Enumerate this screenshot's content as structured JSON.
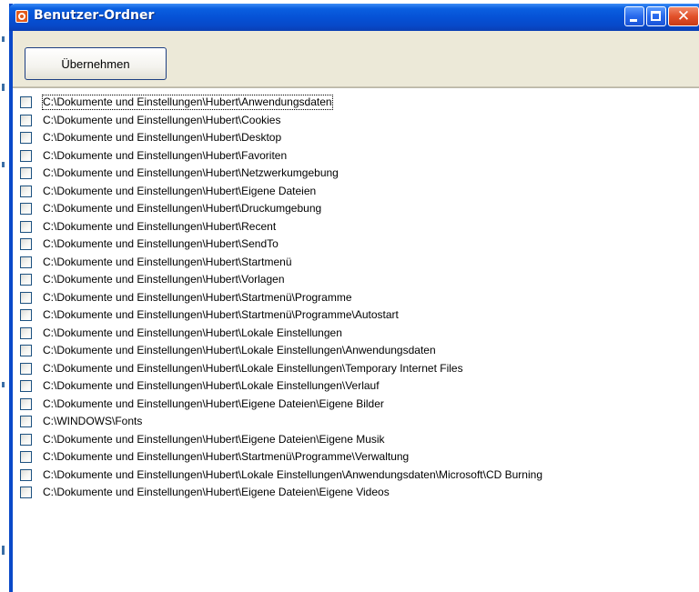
{
  "window": {
    "title": "Benutzer-Ordner",
    "close_glyph": "✕"
  },
  "toolbar": {
    "apply_label": "Übernehmen"
  },
  "colors": {
    "titlebar": "#0652d6",
    "toolbar_bg": "#ece9d8",
    "close_button": "#e2512a",
    "checkbox_border": "#1c5180"
  },
  "icons": {
    "app": "app-icon",
    "minimize": "minimize-icon",
    "maximize": "maximize-icon",
    "close": "close-icon"
  },
  "folders": [
    {
      "path": "C:\\Dokumente und Einstellungen\\Hubert\\Anwendungsdaten",
      "checked": false
    },
    {
      "path": "C:\\Dokumente und Einstellungen\\Hubert\\Cookies",
      "checked": false
    },
    {
      "path": "C:\\Dokumente und Einstellungen\\Hubert\\Desktop",
      "checked": false
    },
    {
      "path": "C:\\Dokumente und Einstellungen\\Hubert\\Favoriten",
      "checked": false
    },
    {
      "path": "C:\\Dokumente und Einstellungen\\Hubert\\Netzwerkumgebung",
      "checked": false
    },
    {
      "path": "C:\\Dokumente und Einstellungen\\Hubert\\Eigene Dateien",
      "checked": false
    },
    {
      "path": "C:\\Dokumente und Einstellungen\\Hubert\\Druckumgebung",
      "checked": false
    },
    {
      "path": "C:\\Dokumente und Einstellungen\\Hubert\\Recent",
      "checked": false
    },
    {
      "path": "C:\\Dokumente und Einstellungen\\Hubert\\SendTo",
      "checked": false
    },
    {
      "path": "C:\\Dokumente und Einstellungen\\Hubert\\Startmenü",
      "checked": false
    },
    {
      "path": "C:\\Dokumente und Einstellungen\\Hubert\\Vorlagen",
      "checked": false
    },
    {
      "path": "C:\\Dokumente und Einstellungen\\Hubert\\Startmenü\\Programme",
      "checked": false
    },
    {
      "path": "C:\\Dokumente und Einstellungen\\Hubert\\Startmenü\\Programme\\Autostart",
      "checked": false
    },
    {
      "path": "C:\\Dokumente und Einstellungen\\Hubert\\Lokale Einstellungen",
      "checked": false
    },
    {
      "path": "C:\\Dokumente und Einstellungen\\Hubert\\Lokale Einstellungen\\Anwendungsdaten",
      "checked": false
    },
    {
      "path": "C:\\Dokumente und Einstellungen\\Hubert\\Lokale Einstellungen\\Temporary Internet Files",
      "checked": false
    },
    {
      "path": "C:\\Dokumente und Einstellungen\\Hubert\\Lokale Einstellungen\\Verlauf",
      "checked": false
    },
    {
      "path": "C:\\Dokumente und Einstellungen\\Hubert\\Eigene Dateien\\Eigene Bilder",
      "checked": false
    },
    {
      "path": "C:\\WINDOWS\\Fonts",
      "checked": false
    },
    {
      "path": "C:\\Dokumente und Einstellungen\\Hubert\\Eigene Dateien\\Eigene Musik",
      "checked": false
    },
    {
      "path": "C:\\Dokumente und Einstellungen\\Hubert\\Startmenü\\Programme\\Verwaltung",
      "checked": false
    },
    {
      "path": "C:\\Dokumente und Einstellungen\\Hubert\\Lokale Einstellungen\\Anwendungsdaten\\Microsoft\\CD Burning",
      "checked": false
    },
    {
      "path": "C:\\Dokumente und Einstellungen\\Hubert\\Eigene Dateien\\Eigene Videos",
      "checked": false
    }
  ]
}
